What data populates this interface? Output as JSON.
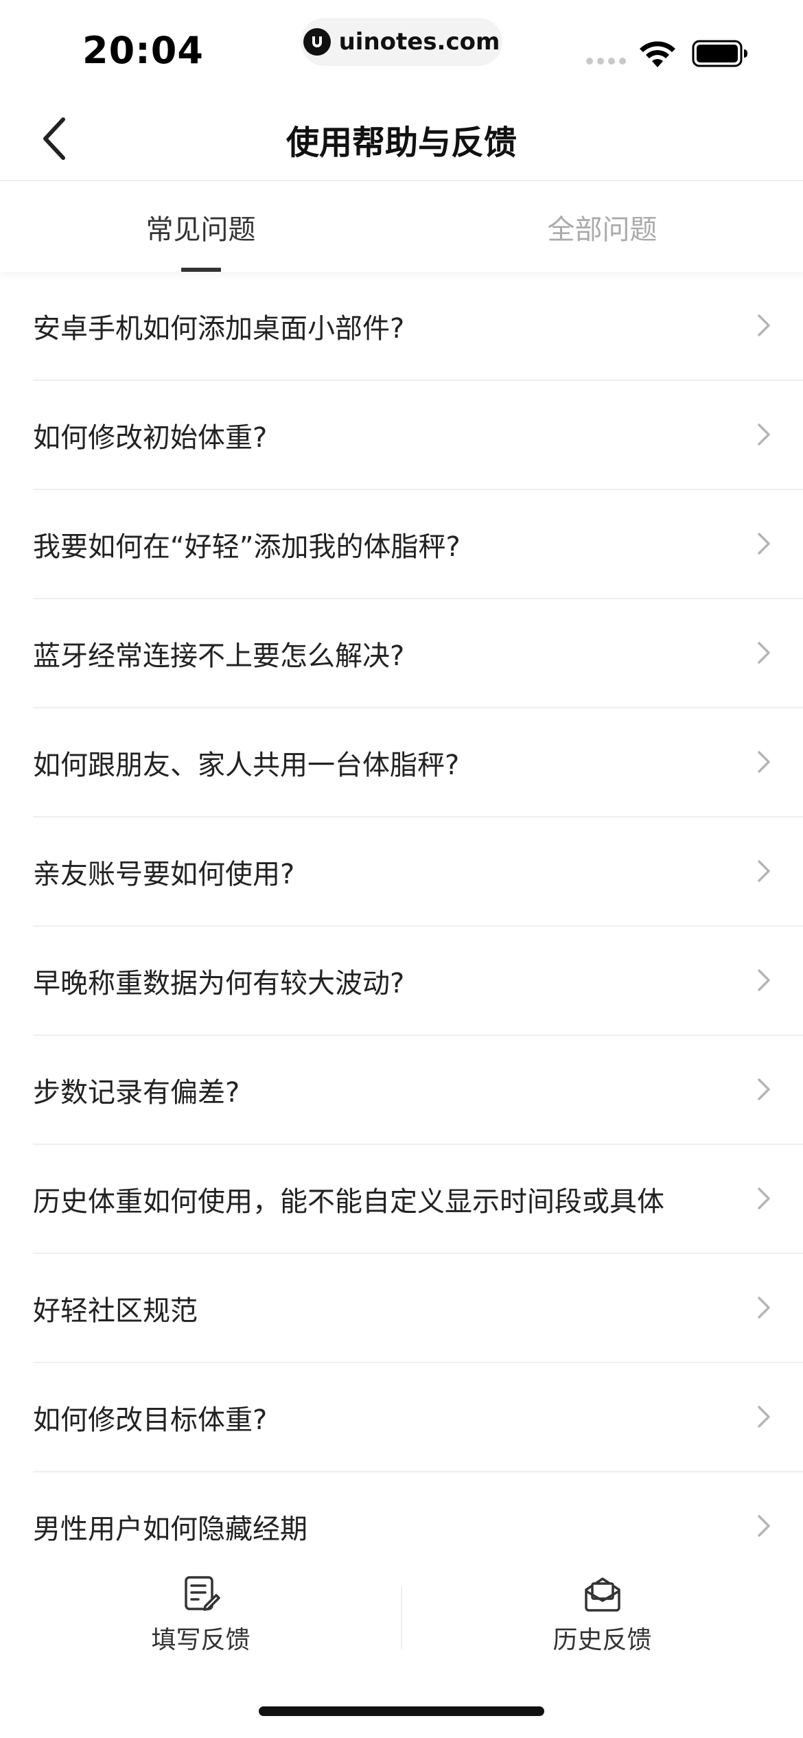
{
  "status_bar": {
    "time": "20:04",
    "url": "uinotes.com",
    "icons": [
      "signal-dots-icon",
      "wifi-icon",
      "battery-icon"
    ]
  },
  "nav": {
    "title": "使用帮助与反馈",
    "back_icon": "chevron-left-icon"
  },
  "tabs": [
    {
      "label": "常见问题",
      "active": true
    },
    {
      "label": "全部问题",
      "active": false
    }
  ],
  "faq_items": [
    {
      "text": "安卓手机如何添加桌面小部件?"
    },
    {
      "text": "如何修改初始体重?"
    },
    {
      "text": "我要如何在“好轻”添加我的体脂秤?"
    },
    {
      "text": "蓝牙经常连接不上要怎么解决?"
    },
    {
      "text": "如何跟朋友、家人共用一台体脂秤?"
    },
    {
      "text": "亲友账号要如何使用?"
    },
    {
      "text": "早晚称重数据为何有较大波动?"
    },
    {
      "text": "步数记录有偏差?"
    },
    {
      "text": "历史体重如何使用，能不能自定义显示时间段或具体"
    },
    {
      "text": "好轻社区规范"
    },
    {
      "text": "如何修改目标体重?"
    },
    {
      "text": "男性用户如何隐藏经期"
    }
  ],
  "bottom_bar": {
    "left": {
      "label": "填写反馈",
      "icon": "edit-note-icon"
    },
    "right": {
      "label": "历史反馈",
      "icon": "envelope-icon"
    }
  },
  "colors": {
    "text_primary": "#222222",
    "tab_inactive": "#aaaaaa",
    "divider": "#efefef",
    "chevron": "#b5b5b5"
  }
}
